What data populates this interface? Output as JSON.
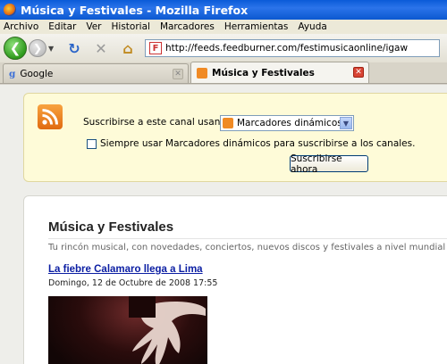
{
  "window": {
    "title": "Música y Festivales - Mozilla Firefox"
  },
  "menu": [
    "Archivo",
    "Editar",
    "Ver",
    "Historial",
    "Marcadores",
    "Herramientas",
    "Ayuda"
  ],
  "toolbar": {
    "url": "http://feeds.feedburner.com/festimusicaonline/igaw"
  },
  "tabs": [
    {
      "label": "Google",
      "icon": "google-g-icon"
    },
    {
      "label": "Música y Festivales",
      "icon": "rss-feed-icon"
    }
  ],
  "subscribe": {
    "label": "Suscribirse a este canal usando",
    "select_value": "Marcadores dinámicos",
    "checkbox_label": "Siempre usar Marcadores dinámicos para suscribirse a los canales.",
    "checkbox_checked": false,
    "button_label": "Suscribirse ahora"
  },
  "feed": {
    "title": "Música y Festivales",
    "subtitle": "Tu rincón musical, con novedades, conciertos, nuevos discos y festivales a nivel mundial",
    "entries": [
      {
        "title": "La fiebre Calamaro llega a Lima",
        "date": "Domingo, 12 de Octubre de 2008 17:55"
      }
    ]
  },
  "colors": {
    "titlebar": "#0a5bd8",
    "subscribe_box": "#fefbd8",
    "link": "#0b1ea3",
    "rss": "#f08a24"
  }
}
